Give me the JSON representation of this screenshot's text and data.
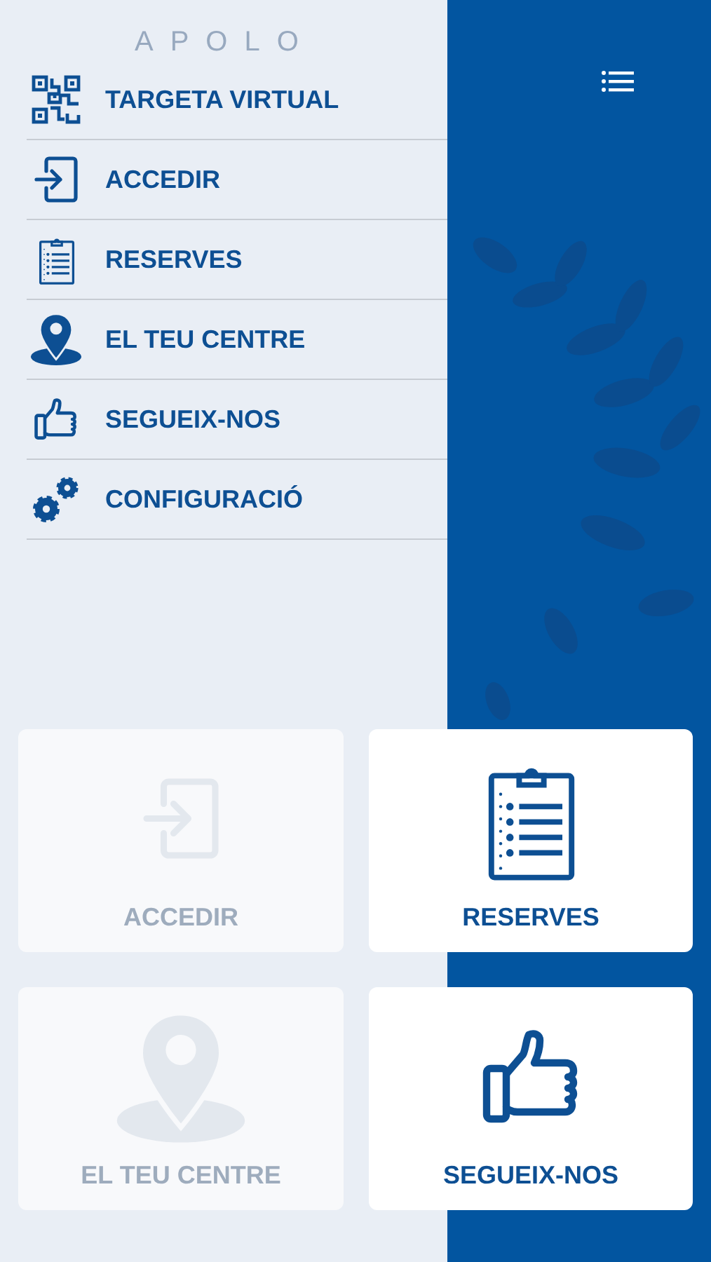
{
  "logo": {
    "text": "APOLO"
  },
  "menu": [
    {
      "label": "TARGETA VIRTUAL",
      "kind": "qr"
    },
    {
      "label": "ACCEDIR",
      "kind": "login"
    },
    {
      "label": "RESERVES",
      "kind": "clipboard"
    },
    {
      "label": "EL TEU CENTRE",
      "kind": "pin"
    },
    {
      "label": "SEGUEIX-NOS",
      "kind": "thumb"
    },
    {
      "label": "CONFIGURACIÓ",
      "kind": "gears"
    }
  ],
  "cards": [
    {
      "label": "ACCEDIR",
      "kind": "login",
      "dimmed": true
    },
    {
      "label": "RESERVES",
      "kind": "clipboard",
      "dimmed": false
    },
    {
      "label": "EL TEU CENTRE",
      "kind": "pin",
      "dimmed": true
    },
    {
      "label": "SEGUEIX-NOS",
      "kind": "thumb",
      "dimmed": false
    }
  ]
}
